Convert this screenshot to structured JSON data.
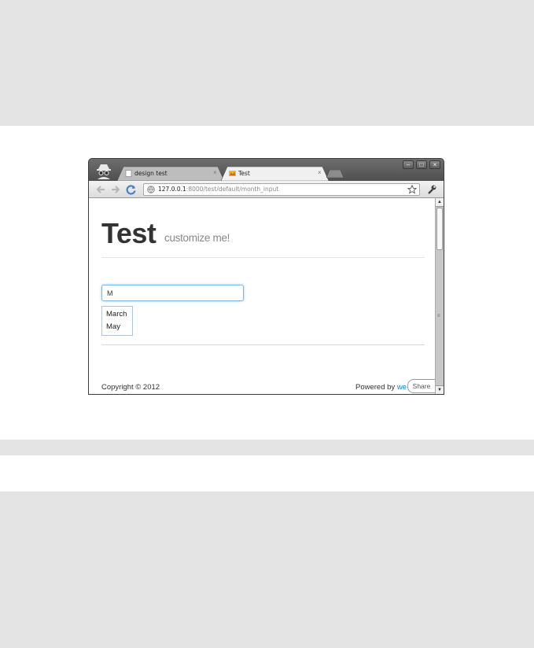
{
  "browser": {
    "tabs": [
      {
        "label": "design test",
        "active": false,
        "close": "×"
      },
      {
        "label": "Test",
        "active": true,
        "close": "×"
      }
    ],
    "window_controls": {
      "minimize": "–",
      "maximize": "□",
      "close": "×"
    },
    "address": {
      "host": "127.0.0.1",
      "rest": ":8000/test/default/month_input"
    },
    "icons": [
      "incognito-icon",
      "back-icon",
      "forward-icon",
      "reload-icon",
      "globe-icon",
      "star-icon",
      "wrench-icon"
    ]
  },
  "page": {
    "title": "Test",
    "subtitle": "customize me!",
    "month_input": {
      "value": "M"
    },
    "suggestions": [
      "March",
      "May"
    ],
    "footer": {
      "copyright": "Copyright © 2012",
      "powered_prefix": "Powered by ",
      "powered_link": "we",
      "share": "Share"
    }
  },
  "colors": {
    "backdrop": "#e4e4e4",
    "link": "#0088cc",
    "input_focus": "#7fb8e6"
  }
}
